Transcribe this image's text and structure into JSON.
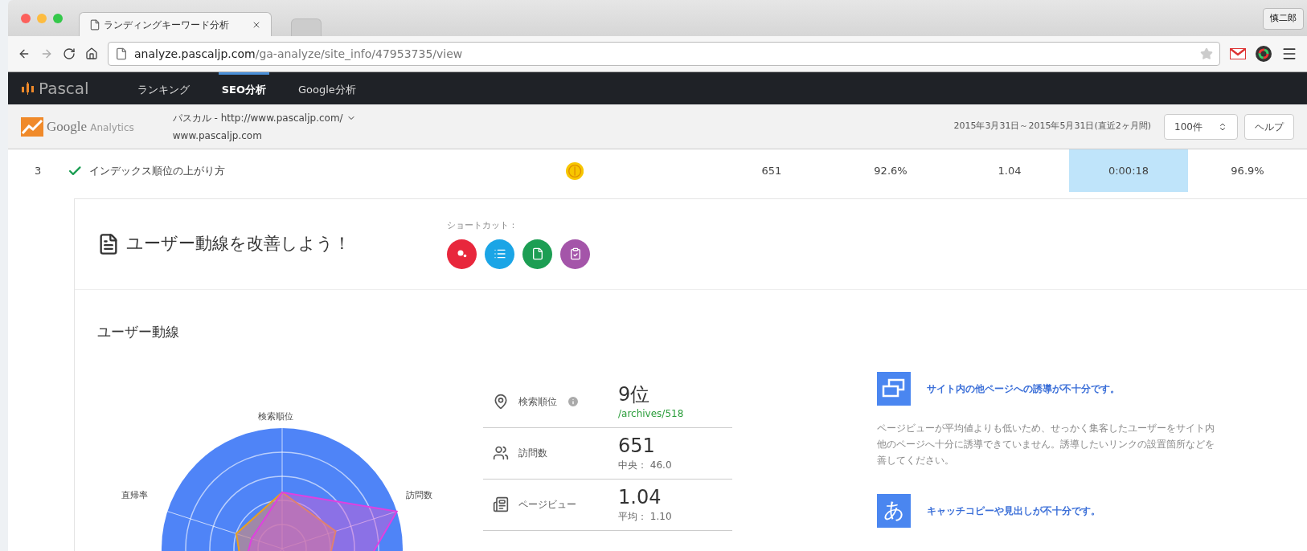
{
  "browser": {
    "tabs": [
      {
        "title": "ランディングキーワード分析",
        "selected": true
      }
    ],
    "profile": "慎二郎",
    "url": {
      "host": "analyze.pascaljp.com",
      "path": "/ga-analyze/site_info/47953735/view"
    }
  },
  "nav": {
    "logo": "Pascal",
    "items": [
      {
        "label": "ランキング",
        "selected": false
      },
      {
        "label": "SEO分析",
        "selected": true
      },
      {
        "label": "Google分析",
        "selected": false
      }
    ]
  },
  "ga_bar": {
    "logo_primary": "Google",
    "logo_secondary": "Analytics",
    "property": "パスカル - http://www.pascaljp.com/",
    "site": "www.pascaljp.com",
    "date_range": "2015年3月31日～2015年5月31日(直近2ヶ月間)",
    "per_page": "100件",
    "help": "ヘルプ"
  },
  "row": {
    "rank": "3",
    "checked": true,
    "title": "インデックス順位の上がり方",
    "cells": [
      {
        "text": "651",
        "highlighted": false
      },
      {
        "text": "92.6%",
        "highlighted": false
      },
      {
        "text": "1.04",
        "highlighted": false
      },
      {
        "text": "0:00:18",
        "highlighted": true
      },
      {
        "text": "96.9%",
        "highlighted": false
      }
    ]
  },
  "panel": {
    "title": "ユーザー動線を改善しよう！",
    "shortcut_label": "ショートカット：",
    "shortcuts": [
      {
        "kind": "dots",
        "color": "#e8273c"
      },
      {
        "kind": "list",
        "color": "#1ba5e6"
      },
      {
        "kind": "page",
        "color": "#1c9e53"
      },
      {
        "kind": "check",
        "color": "#a455a9"
      }
    ],
    "section_title": "ユーザー動線",
    "radar_labels": [
      {
        "text": "検索順位"
      },
      {
        "text": "訪問数"
      },
      {
        "text": "直帰率"
      }
    ],
    "stats": [
      {
        "kind": "rank",
        "label": "検索順位",
        "info": true,
        "value": "9位",
        "sub": "/archives/518",
        "sub_link": true
      },
      {
        "kind": "visits",
        "label": "訪問数",
        "info": false,
        "value": "651",
        "sub": "中央： 46.0",
        "sub_link": false
      },
      {
        "kind": "pageviews",
        "label": "ページビュー",
        "info": false,
        "value": "1.04",
        "sub": "平均： 1.10",
        "sub_link": false
      }
    ],
    "advice": [
      {
        "kind": "windows",
        "title": "サイト内の他ページへの誘導が不十分です。",
        "lines": [
          "ページビューが平均値よりも低いため、せっかく集客したユーザーをサイト内",
          "他のページへ十分に誘導できていません。誘導したいリンクの設置箇所などを",
          "善してください。"
        ]
      },
      {
        "kind": "glyph",
        "glyph": "あ",
        "title": "キャッチコピーや見出しが不十分です。"
      }
    ]
  }
}
